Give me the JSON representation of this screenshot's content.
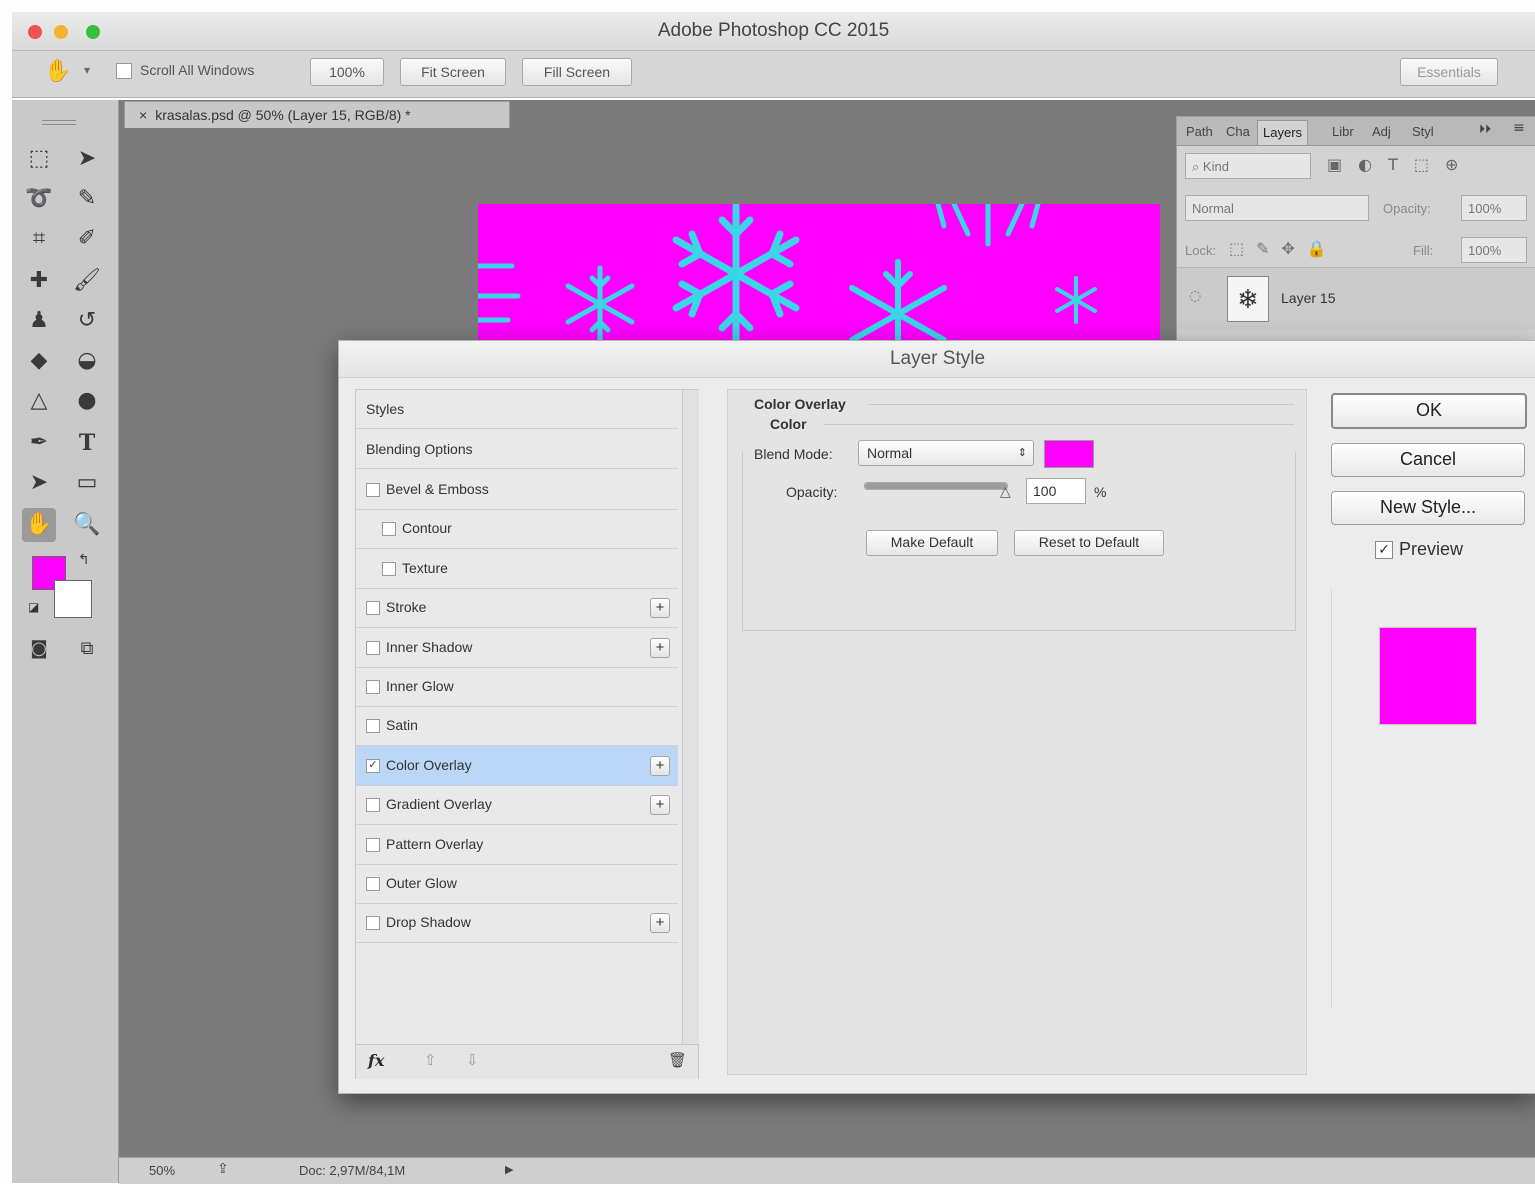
{
  "window": {
    "title": "Adobe Photoshop CC 2015"
  },
  "options_bar": {
    "scroll_all_windows": "Scroll All Windows",
    "zoom_100": "100%",
    "fit_screen": "Fit Screen",
    "fill_screen": "Fill Screen",
    "workspace": "Essentials"
  },
  "document": {
    "tab_label": "krasalas.psd @ 50% (Layer 15, RGB/8) *",
    "close_glyph": "×"
  },
  "status_bar": {
    "zoom": "50%",
    "doc_size": "Doc: 2,97M/84,1M",
    "arrow": "▶"
  },
  "layers_panel": {
    "tabs": [
      "Path",
      "Cha",
      "Layers",
      "Libr",
      "Adj",
      "Styl"
    ],
    "kind_filter": "Kind",
    "blend_mode": "Normal",
    "opacity_label": "Opacity:",
    "opacity_value": "100%",
    "lock_label": "Lock:",
    "fill_label": "Fill:",
    "fill_value": "100%",
    "layer_name": "Layer 15"
  },
  "dialog": {
    "title": "Layer Style",
    "styles_list": {
      "header": "Styles",
      "blending_options": "Blending Options",
      "items": [
        {
          "label": "Bevel & Emboss",
          "checked": false,
          "indent": false,
          "has_plus": false
        },
        {
          "label": "Contour",
          "checked": false,
          "indent": true,
          "has_plus": false
        },
        {
          "label": "Texture",
          "checked": false,
          "indent": true,
          "has_plus": false
        },
        {
          "label": "Stroke",
          "checked": false,
          "indent": false,
          "has_plus": true
        },
        {
          "label": "Inner Shadow",
          "checked": false,
          "indent": false,
          "has_plus": true
        },
        {
          "label": "Inner Glow",
          "checked": false,
          "indent": false,
          "has_plus": false
        },
        {
          "label": "Satin",
          "checked": false,
          "indent": false,
          "has_plus": false
        },
        {
          "label": "Color Overlay",
          "checked": true,
          "indent": false,
          "has_plus": true,
          "selected": true
        },
        {
          "label": "Gradient Overlay",
          "checked": false,
          "indent": false,
          "has_plus": true
        },
        {
          "label": "Pattern Overlay",
          "checked": false,
          "indent": false,
          "has_plus": false
        },
        {
          "label": "Outer Glow",
          "checked": false,
          "indent": false,
          "has_plus": false
        },
        {
          "label": "Drop Shadow",
          "checked": false,
          "indent": false,
          "has_plus": true
        }
      ],
      "footer_fx": "fx"
    },
    "color_overlay": {
      "section_title": "Color Overlay",
      "group_title": "Color",
      "blend_mode_label": "Blend Mode:",
      "blend_mode_value": "Normal",
      "overlay_color": "#ff00ff",
      "opacity_label": "Opacity:",
      "opacity_value": "100",
      "opacity_unit": "%",
      "make_default": "Make Default",
      "reset_default": "Reset to Default"
    },
    "buttons": {
      "ok": "OK",
      "cancel": "Cancel",
      "new_style": "New Style...",
      "preview": "Preview"
    },
    "preview_checked": true,
    "preview_color": "#ff00ff"
  },
  "colors": {
    "foreground": "#ff00ff",
    "background": "#ffffff",
    "canvas_bg": "#ff00ff",
    "snowflake": "#3ad6e6"
  }
}
